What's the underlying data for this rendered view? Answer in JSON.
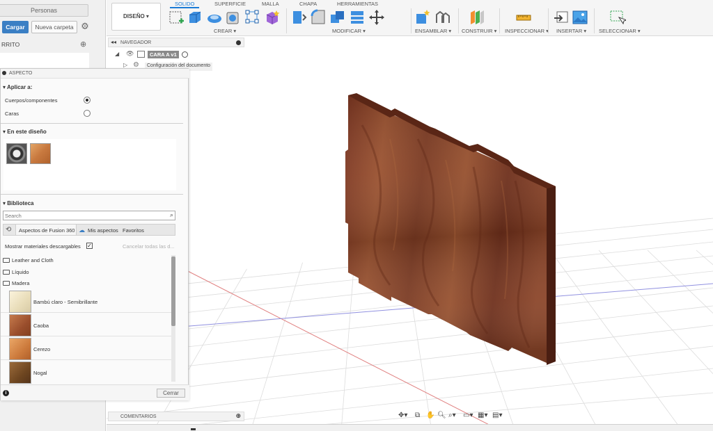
{
  "data_panel": {
    "tab_people": "Personas",
    "upload": "Cargar",
    "new_folder": "Nueva carpeta",
    "project_partial": "RRITO"
  },
  "toolbar": {
    "workspace": "DISEÑO ▾",
    "tabs": [
      "SOLIDO",
      "SUPERFICIE",
      "MALLA",
      "CHAPA",
      "HERRAMIENTAS"
    ],
    "groups": {
      "create": "CREAR ▾",
      "modify": "MODIFICAR ▾",
      "assemble": "ENSAMBLAR ▾",
      "construct": "CONSTRUIR ▾",
      "inspect": "INSPECCIONAR ▾",
      "insert": "INSERTAR ▾",
      "select": "SELECCIONAR ▾"
    }
  },
  "navigator": {
    "title": "NAVEGADOR",
    "root": "CARA A v1",
    "doc_settings": "Configuración del documento"
  },
  "appearance": {
    "title": "ASPECTO",
    "apply_to": "Aplicar a:",
    "bodies": "Cuerpos/componentes",
    "faces": "Caras",
    "in_design": "En este diseño",
    "library": "Biblioteca",
    "search_placeholder": "Search",
    "lib_tabs": [
      "Aspectos de Fusion 360",
      "Mis aspectos",
      "Favoritos"
    ],
    "show_downloadable": "Mostrar materiales descargables",
    "cancel_all": "Cancelar todas las d...",
    "folders": [
      "Leather and Cloth",
      "Líquido",
      "Madera"
    ],
    "materials": [
      "Bambú claro - Semibrillante",
      "Caoba",
      "Cerezo",
      "Nogal"
    ],
    "close": "Cerrar"
  },
  "comments": {
    "title": "COMENTARIOS"
  },
  "colors": {
    "accent": "#1a7bd6",
    "upload_button": "#3b7fc4",
    "wood_dark": "#6b2e1a",
    "wood_mid": "#8f4a2c",
    "axis_red": "#e08080",
    "axis_blue": "#9090e0"
  }
}
